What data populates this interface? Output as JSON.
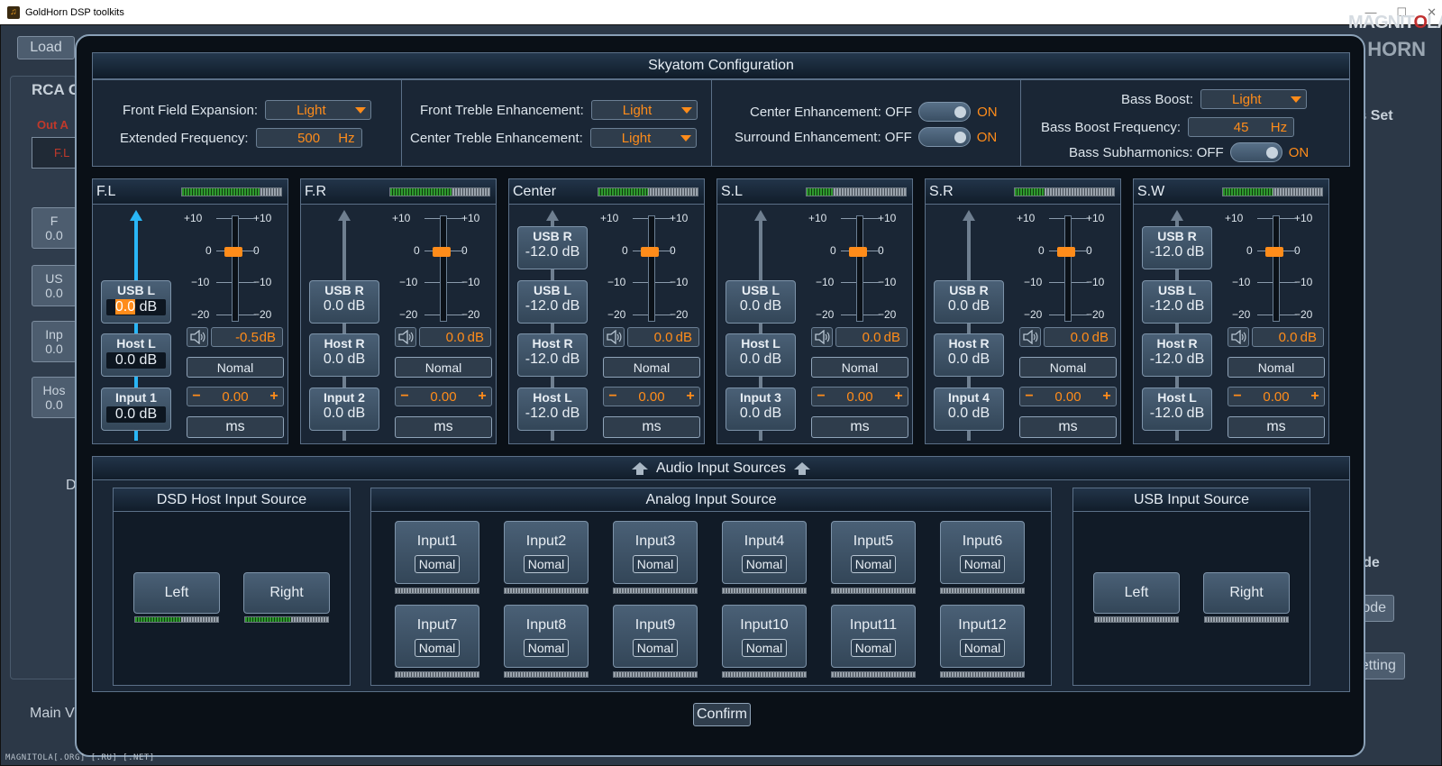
{
  "window": {
    "title": "GoldHorn DSP toolkits"
  },
  "logo": {
    "line1a": "MAGNIT",
    "line1b": "O",
    "line1c": "LA",
    "line2": "HORN"
  },
  "watermark": "MAGNITOLA[.ORG] [.RU] [.NET]",
  "background": {
    "load": "Load",
    "rca": "RCA C",
    "out": "Out A",
    "fl": "F.L",
    "side_f": "F",
    "side_val1": "0.0",
    "side_us": "US",
    "side_val2": "0.0",
    "side_inp": "Inp",
    "side_val3": "0.0",
    "side_hos": "Hos",
    "side_val4": "0.0",
    "d": "D",
    "bias": "ias Set",
    "mode_label": "Mode",
    "mode_btn": "Mode",
    "setting": "Setting",
    "main": "Main V"
  },
  "dialog": {
    "title": "Skyatom Configuration",
    "front_field_label": "Front Field Expansion:",
    "front_field_value": "Light",
    "ext_freq_label": "Extended Frequency:",
    "ext_freq_value": "500",
    "ext_freq_unit": "Hz",
    "front_treble_label": "Front Treble Enhancement:",
    "front_treble_value": "Light",
    "center_treble_label": "Center Treble Enhancement:",
    "center_treble_value": "Light",
    "center_enh_label": "Center Enhancement: OFF",
    "surround_enh_label": "Surround Enhancement: OFF",
    "on_label": "ON",
    "bass_boost_label": "Bass Boost:",
    "bass_boost_value": "Light",
    "bass_freq_label": "Bass Boost Frequency:",
    "bass_freq_value": "45",
    "bass_freq_unit": "Hz",
    "bass_sub_label": "Bass Subharmonics: OFF",
    "confirm": "Confirm"
  },
  "fader_scale": {
    "p10": "+10",
    "z": "0",
    "m10": "−10",
    "m20": "−20"
  },
  "channels": [
    {
      "name": "F.L",
      "meter": 0.78,
      "arrow_active": true,
      "sources": [
        {
          "title": "USB L",
          "value": "0.0",
          "unit": "dB",
          "active": true,
          "highlight": true
        },
        {
          "title": "Host L",
          "value": "0.0 dB",
          "active": true
        },
        {
          "title": "Input 1",
          "value": "0.0 dB",
          "active": true
        }
      ],
      "gain": "-0.5",
      "gain_unit": "dB",
      "mode": "Nomal",
      "delay": "0.00",
      "ms": "ms"
    },
    {
      "name": "F.R",
      "meter": 0.62,
      "sources": [
        {
          "title": "USB R",
          "value": "0.0 dB"
        },
        {
          "title": "Host R",
          "value": "0.0 dB"
        },
        {
          "title": "Input 2",
          "value": "0.0 dB"
        }
      ],
      "gain": "0.0",
      "gain_unit": "dB",
      "mode": "Nomal",
      "delay": "0.00",
      "ms": "ms"
    },
    {
      "name": "Center",
      "meter": 0.5,
      "four": true,
      "sources": [
        {
          "title": "USB R",
          "value": "-12.0 dB"
        },
        {
          "title": "USB L",
          "value": "-12.0 dB"
        },
        {
          "title": "Host R",
          "value": "-12.0 dB"
        },
        {
          "title": "Host L",
          "value": "-12.0 dB"
        }
      ],
      "gain": "0.0",
      "gain_unit": "dB",
      "mode": "Nomal",
      "delay": "0.00",
      "ms": "ms"
    },
    {
      "name": "S.L",
      "meter": 0.26,
      "sources": [
        {
          "title": "USB L",
          "value": "0.0 dB"
        },
        {
          "title": "Host L",
          "value": "0.0 dB"
        },
        {
          "title": "Input 3",
          "value": "0.0 dB"
        }
      ],
      "gain": "0.0",
      "gain_unit": "dB",
      "mode": "Nomal",
      "delay": "0.00",
      "ms": "ms"
    },
    {
      "name": "S.R",
      "meter": 0.3,
      "sources": [
        {
          "title": "USB R",
          "value": "0.0 dB"
        },
        {
          "title": "Host R",
          "value": "0.0 dB"
        },
        {
          "title": "Input 4",
          "value": "0.0 dB"
        }
      ],
      "gain": "0.0",
      "gain_unit": "dB",
      "mode": "Nomal",
      "delay": "0.00",
      "ms": "ms"
    },
    {
      "name": "S.W",
      "meter": 0.5,
      "four": true,
      "sources": [
        {
          "title": "USB R",
          "value": "-12.0 dB"
        },
        {
          "title": "USB L",
          "value": "-12.0 dB"
        },
        {
          "title": "Host R",
          "value": "-12.0 dB"
        },
        {
          "title": "Host L",
          "value": "-12.0 dB"
        }
      ],
      "gain": "0.0",
      "gain_unit": "dB",
      "mode": "Nomal",
      "delay": "0.00",
      "ms": "ms"
    }
  ],
  "audio_sources": {
    "title": "Audio Input Sources",
    "dsd_title": "DSD Host Input Source",
    "dsd_left": "Left",
    "dsd_right": "Right",
    "dsd_left_level": 0.55,
    "dsd_right_level": 0.55,
    "analog_title": "Analog Input Source",
    "analog_mode": "Nomal",
    "inputs": [
      "Input1",
      "Input2",
      "Input3",
      "Input4",
      "Input5",
      "Input6",
      "Input7",
      "Input8",
      "Input9",
      "Input10",
      "Input11",
      "Input12"
    ],
    "usb_title": "USB Input Source",
    "usb_left": "Left",
    "usb_right": "Right"
  }
}
